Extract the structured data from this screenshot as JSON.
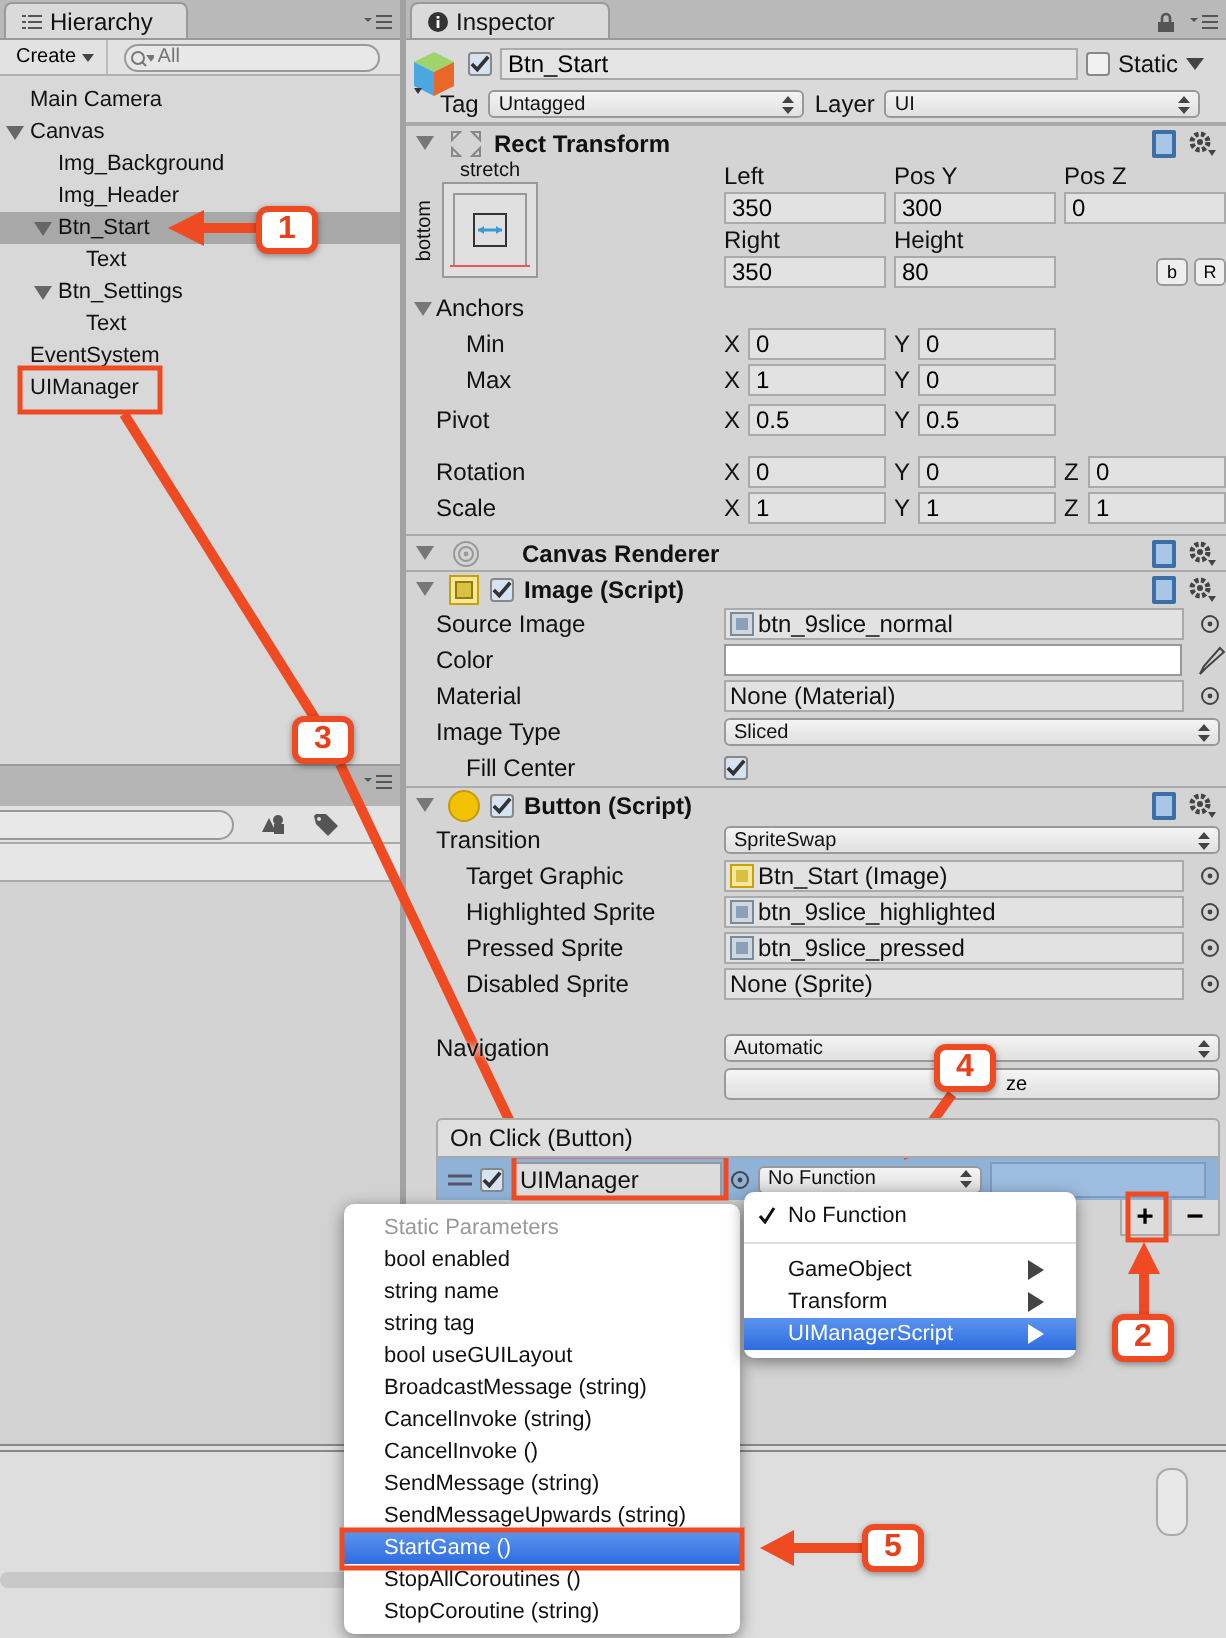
{
  "hierarchy": {
    "title": "Hierarchy",
    "create": "Create",
    "search": {
      "placeholder": "All"
    },
    "items": [
      {
        "label": "Main Camera",
        "selected": false
      },
      {
        "label": "Canvas",
        "selected": false,
        "expanded": true,
        "children": [
          {
            "label": "Img_Background",
            "selected": false
          },
          {
            "label": "Img_Header",
            "selected": false
          },
          {
            "label": "Btn_Start",
            "selected": true,
            "expanded": true,
            "children": [
              {
                "label": "Text",
                "selected": false
              }
            ]
          },
          {
            "label": "Btn_Settings",
            "selected": false,
            "expanded": true,
            "children": [
              {
                "label": "Text",
                "selected": false
              }
            ]
          }
        ]
      },
      {
        "label": "EventSystem",
        "selected": false
      },
      {
        "label": "UIManager",
        "selected": false
      }
    ]
  },
  "inspector": {
    "title": "Inspector",
    "object": {
      "active": true,
      "name": "Btn_Start",
      "static_label": "Static",
      "static": false,
      "tag_label": "Tag",
      "tag": "Untagged",
      "layer_label": "Layer",
      "layer": "UI"
    },
    "rect_transform": {
      "title": "Rect Transform",
      "expanded": true,
      "anchor_preset": "stretch",
      "anchor_side": "bottom",
      "fields": [
        {
          "label": "Left",
          "value": "350"
        },
        {
          "label": "Pos Y",
          "value": "300"
        },
        {
          "label": "Pos Z",
          "value": "0"
        },
        {
          "label": "Right",
          "value": "350"
        },
        {
          "label": "Height",
          "value": "80"
        }
      ],
      "buttons": [
        "b",
        "R"
      ],
      "anchors": {
        "label": "Anchors",
        "expanded": true,
        "rows": [
          {
            "label": "Min",
            "axes": [
              {
                "axis": "X",
                "value": "0"
              },
              {
                "axis": "Y",
                "value": "0"
              }
            ]
          },
          {
            "label": "Max",
            "axes": [
              {
                "axis": "X",
                "value": "1"
              },
              {
                "axis": "Y",
                "value": "0"
              }
            ]
          }
        ]
      },
      "rows": [
        {
          "label": "Pivot",
          "axes": [
            {
              "axis": "X",
              "value": "0.5"
            },
            {
              "axis": "Y",
              "value": "0.5"
            }
          ]
        },
        {
          "label": "Rotation",
          "axes": [
            {
              "axis": "X",
              "value": "0"
            },
            {
              "axis": "Y",
              "value": "0"
            },
            {
              "axis": "Z",
              "value": "0"
            }
          ]
        },
        {
          "label": "Scale",
          "axes": [
            {
              "axis": "X",
              "value": "1"
            },
            {
              "axis": "Y",
              "value": "1"
            },
            {
              "axis": "Z",
              "value": "1"
            }
          ]
        }
      ]
    },
    "components": [
      {
        "kind": "canvas_renderer",
        "title": "Canvas Renderer",
        "expanded": true
      },
      {
        "kind": "image",
        "title": "Image (Script)",
        "expanded": true,
        "enabled": true,
        "properties": [
          {
            "kind": "sprite_object",
            "label": "Source Image",
            "value": "btn_9slice_normal",
            "indented": false
          },
          {
            "kind": "color",
            "label": "Color",
            "color": "#ffffff",
            "indented": false
          },
          {
            "kind": "object",
            "label": "Material",
            "value": "None (Material)",
            "indented": false
          },
          {
            "kind": "enum",
            "label": "Image Type",
            "value": "Sliced",
            "indented": false
          },
          {
            "kind": "toggle",
            "label": "Fill Center",
            "checked": true,
            "indented": true
          }
        ]
      },
      {
        "kind": "button",
        "title": "Button (Script)",
        "expanded": true,
        "enabled": true,
        "properties": [
          {
            "kind": "enum",
            "label": "Transition",
            "value": "SpriteSwap",
            "indented": false
          },
          {
            "kind": "image_object",
            "label": "Target Graphic",
            "value": "Btn_Start  (Image)",
            "indented": true
          },
          {
            "kind": "sprite_object",
            "label": "Highlighted Sprite",
            "value": "btn_9slice_highlighted",
            "indented": true
          },
          {
            "kind": "sprite_object",
            "label": "Pressed Sprite",
            "value": "btn_9slice_pressed",
            "indented": true
          },
          {
            "kind": "object",
            "label": "Disabled Sprite",
            "value": "None (Sprite)",
            "indented": true
          }
        ],
        "navigation": {
          "label": "Navigation",
          "value": "Automatic"
        },
        "visualize_button": "ze",
        "on_click": {
          "title": "On Click (Button)",
          "entries": [
            {
              "enabled": true,
              "target": "UIManager",
              "function": "No Function"
            }
          ],
          "add": "+",
          "remove": "−"
        }
      }
    ]
  },
  "function_menu": {
    "items": [
      {
        "kind": "item",
        "label": "No Function",
        "checked": true,
        "selected": false
      },
      {
        "kind": "separator"
      },
      {
        "kind": "submenu",
        "label": "GameObject",
        "checked": false,
        "selected": false
      },
      {
        "kind": "submenu",
        "label": "Transform",
        "checked": false,
        "selected": false
      },
      {
        "kind": "submenu",
        "label": "UIManagerScript",
        "checked": false,
        "selected": true
      }
    ]
  },
  "method_menu": {
    "items": [
      {
        "kind": "header",
        "label": "Static Parameters"
      },
      {
        "kind": "item",
        "label": "bool enabled",
        "selected": false
      },
      {
        "kind": "item",
        "label": "string name",
        "selected": false
      },
      {
        "kind": "item",
        "label": "string tag",
        "selected": false
      },
      {
        "kind": "item",
        "label": "bool useGUILayout",
        "selected": false
      },
      {
        "kind": "item",
        "label": "BroadcastMessage (string)",
        "selected": false
      },
      {
        "kind": "item",
        "label": "CancelInvoke (string)",
        "selected": false
      },
      {
        "kind": "item",
        "label": "CancelInvoke ()",
        "selected": false
      },
      {
        "kind": "item",
        "label": "SendMessage (string)",
        "selected": false
      },
      {
        "kind": "item",
        "label": "SendMessageUpwards (string)",
        "selected": false
      },
      {
        "kind": "item",
        "label": "StartGame ()",
        "selected": true
      },
      {
        "kind": "item",
        "label": "StopAllCoroutines ()",
        "selected": false
      },
      {
        "kind": "item",
        "label": "StopCoroutine (string)",
        "selected": false
      }
    ]
  },
  "annotations": [
    {
      "label": "1"
    },
    {
      "label": "2"
    },
    {
      "label": "3"
    },
    {
      "label": "4"
    },
    {
      "label": "5"
    }
  ]
}
